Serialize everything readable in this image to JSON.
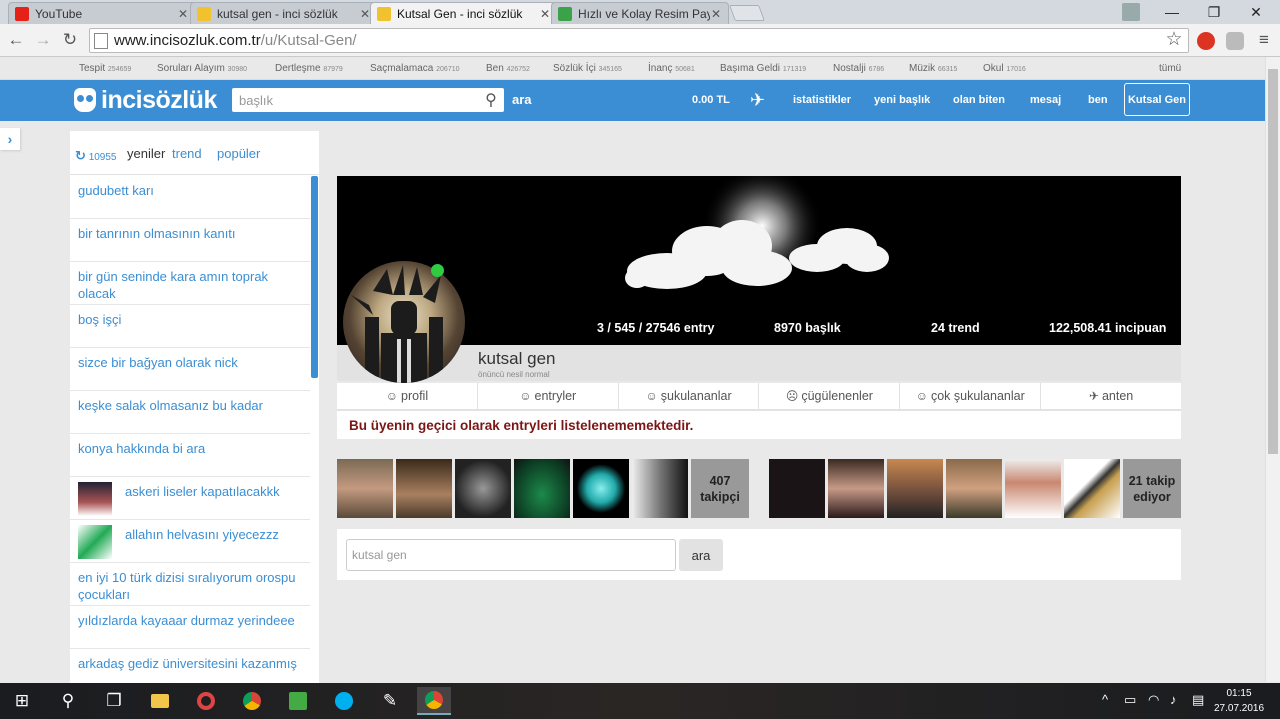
{
  "browser": {
    "tabs": [
      {
        "title": "YouTube",
        "color": "#e62117"
      },
      {
        "title": "kutsal gen - inci sözlük",
        "color": "#f2c12e"
      },
      {
        "title": "Kutsal Gen - inci sözlük",
        "color": "#f2c12e"
      },
      {
        "title": "Hızlı ve Kolay Resim Payla",
        "color": "#3aa34a"
      }
    ],
    "url_domain": "www.incisozluk.com.tr",
    "url_path": "/u/Kutsal-Gen/"
  },
  "categories": [
    {
      "name": "Tespit",
      "count": "254659"
    },
    {
      "name": "Soruları Alayım",
      "count": "30980"
    },
    {
      "name": "Dertleşme",
      "count": "87979"
    },
    {
      "name": "Saçmalamaca",
      "count": "206710"
    },
    {
      "name": "Ben",
      "count": "426752"
    },
    {
      "name": "Sözlük İçi",
      "count": "345165"
    },
    {
      "name": "İnanç",
      "count": "50681"
    },
    {
      "name": "Başıma Geldi",
      "count": "171319"
    },
    {
      "name": "Nostalji",
      "count": "6786"
    },
    {
      "name": "Müzik",
      "count": "66315"
    },
    {
      "name": "Okul",
      "count": "17016"
    }
  ],
  "categories_all": "tümü",
  "header": {
    "logo": "incisözlük",
    "search_placeholder": "başlık",
    "search_btn": "ara",
    "balance": "0.00 TL",
    "links": [
      "istatistikler",
      "yeni başlık",
      "olan biten",
      "mesaj",
      "ben"
    ],
    "user": "Kutsal Gen"
  },
  "left": {
    "refresh_count": "10955",
    "tabs": [
      "yeniler",
      "trend",
      "popüler"
    ],
    "items": [
      {
        "text": "gudubett karı",
        "thumb": false
      },
      {
        "text": "bir tanrının olmasının kanıtı",
        "thumb": false
      },
      {
        "text": "bir gün seninde kara amın toprak olacak",
        "thumb": false
      },
      {
        "text": "boş işçi",
        "thumb": false
      },
      {
        "text": "sizce bir bağyan olarak nick",
        "thumb": false
      },
      {
        "text": "keşke salak olmasanız bu kadar",
        "thumb": false
      },
      {
        "text": "konya hakkında bi ara",
        "thumb": false
      },
      {
        "text": "askeri liseler kapatılacakkk",
        "thumb": true
      },
      {
        "text": "allahın helvasını yiyecezzz",
        "thumb": true
      },
      {
        "text": "en iyi 10 türk dizisi sıralıyorum orospu çocukları",
        "thumb": false
      },
      {
        "text": "yıldızlarda kayaaar durmaz yerindeee",
        "thumb": false
      },
      {
        "text": "arkadaş gediz üniversitesini kazanmış",
        "thumb": false
      }
    ]
  },
  "profile": {
    "stats": [
      "3 / 545 / 27546 entry",
      "8970 başlık",
      "24 trend",
      "122,508.41 incipuan"
    ],
    "name": "kutsal gen",
    "rank": "önüncü nesil normal",
    "tabs": [
      {
        "label": "profil",
        "icon": "☺"
      },
      {
        "label": "entryler",
        "icon": "☺"
      },
      {
        "label": "şukulananlar",
        "icon": "☺"
      },
      {
        "label": "çügülenenler",
        "icon": "☹"
      },
      {
        "label": "çok şukulananlar",
        "icon": "☺"
      },
      {
        "label": "anten",
        "icon": "✈"
      }
    ],
    "notice": "Bu üyenin geçici olarak entryleri listelenememektedir.",
    "followers_label": "407 takipçi",
    "following_label": "21 takip ediyor",
    "search_value": "kutsal gen",
    "search_btn": "ara"
  },
  "taskbar": {
    "time": "01:15",
    "date": "27.07.2016"
  }
}
